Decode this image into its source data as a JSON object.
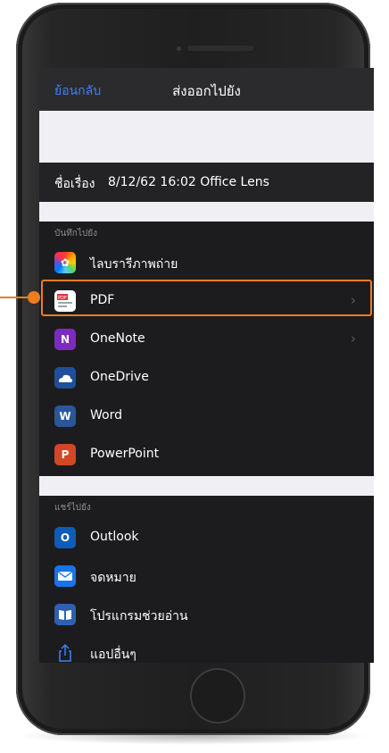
{
  "nav": {
    "back_label": "ย้อนกลับ",
    "title": "ส่งออกไปยัง"
  },
  "document": {
    "title_label": "ชื่อเรื่อง",
    "title_value": "8/12/62 16:02 Office Lens"
  },
  "save_section": {
    "header": "บันทึกไปยัง",
    "items": [
      {
        "label": "ไลบรารีภาพถ่าย",
        "icon": "photos-icon",
        "chevron": false
      },
      {
        "label": "PDF",
        "icon": "pdf-icon",
        "chevron": true
      },
      {
        "label": "OneNote",
        "icon": "onenote-icon",
        "chevron": true
      },
      {
        "label": "OneDrive",
        "icon": "onedrive-icon",
        "chevron": false
      },
      {
        "label": "Word",
        "icon": "word-icon",
        "chevron": false
      },
      {
        "label": "PowerPoint",
        "icon": "powerpoint-icon",
        "chevron": false
      }
    ]
  },
  "share_section": {
    "header": "แชร์ไปยัง",
    "items": [
      {
        "label": "Outlook",
        "icon": "outlook-icon"
      },
      {
        "label": "จดหมาย",
        "icon": "mail-icon"
      },
      {
        "label": "โปรแกรมช่วยอ่าน",
        "icon": "immersive-reader-icon"
      },
      {
        "label": "แอปอื่นๆ",
        "icon": "share-icon"
      }
    ]
  },
  "chevron_glyph": "›",
  "colors": {
    "accent_blue": "#3b82f6",
    "highlight_orange": "#f07c20",
    "screen_bg": "#1c1c1e",
    "separator_light": "#efeff4"
  }
}
